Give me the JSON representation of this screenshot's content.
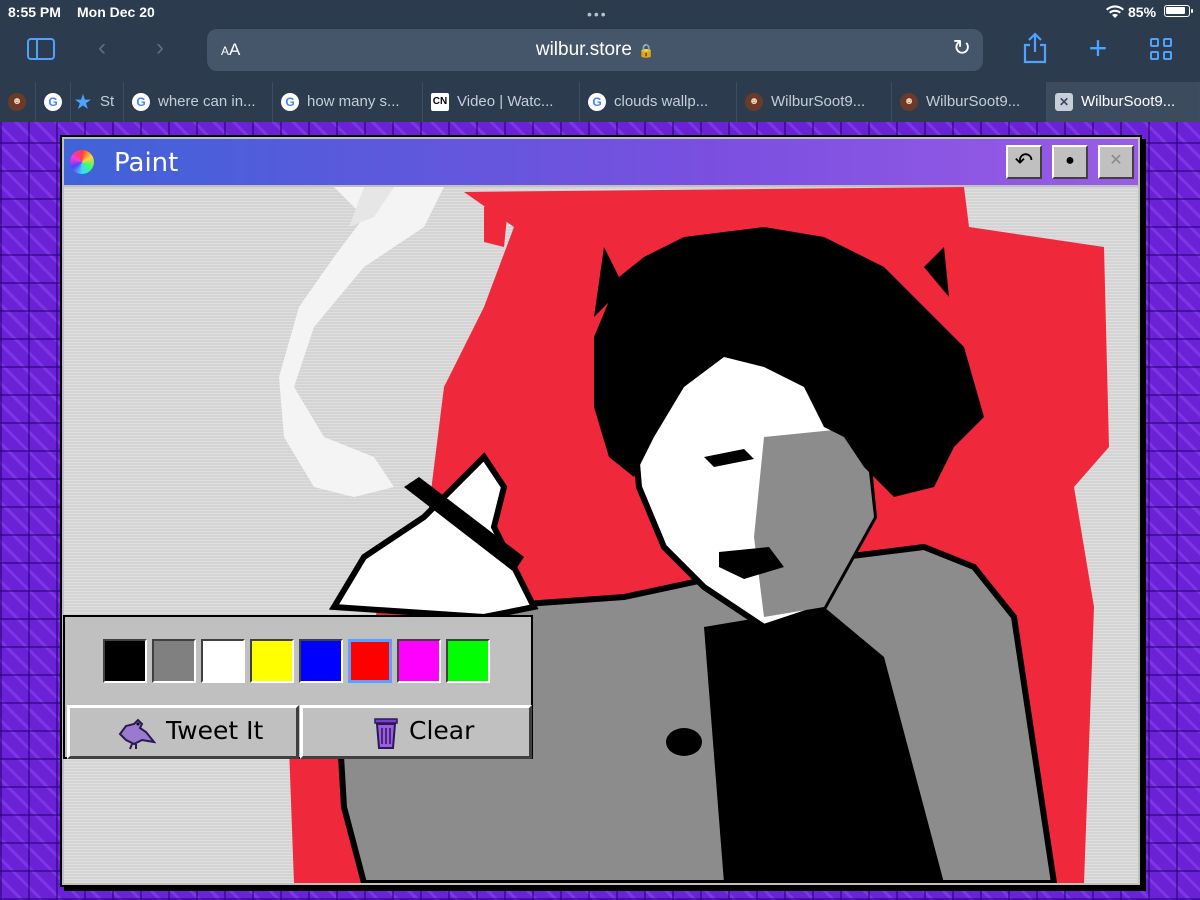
{
  "status": {
    "time": "8:55 PM",
    "date": "Mon Dec 20",
    "battery": "85%"
  },
  "browser": {
    "url": "wilbur.store",
    "text_size_label": "AA",
    "tabs": [
      {
        "label": "",
        "icon": "face-favicon"
      },
      {
        "label": "",
        "icon": "google-favicon"
      },
      {
        "label": "St",
        "icon": "star-favicon"
      },
      {
        "label": "where can in...",
        "icon": "google-favicon"
      },
      {
        "label": "how many s...",
        "icon": "google-favicon"
      },
      {
        "label": "Video | Watc...",
        "icon": "cn-favicon"
      },
      {
        "label": "clouds wallp...",
        "icon": "google-favicon"
      },
      {
        "label": "WilburSoot9...",
        "icon": "face-favicon"
      },
      {
        "label": "WilburSoot9...",
        "icon": "face-favicon"
      },
      {
        "label": "WilburSoot9...",
        "icon": "x-favicon"
      }
    ]
  },
  "paint": {
    "title": "Paint",
    "buttons": {
      "tweet": "Tweet It",
      "clear": "Clear"
    },
    "palette": [
      "#000000",
      "#808080",
      "#ffffff",
      "#ffff00",
      "#0000ff",
      "#ff0000",
      "#ff00ff",
      "#00ff00"
    ],
    "selected_color": "#ff0000",
    "window_buttons": [
      "undo-icon",
      "brush-size-icon",
      "close-icon"
    ]
  },
  "colors": {
    "accent": "#4da3ff",
    "page_bg": "#6b22d6",
    "title_gradient_start": "#3f63d8",
    "title_gradient_end": "#9a5ce6",
    "drawing_red": "#f0283c"
  }
}
